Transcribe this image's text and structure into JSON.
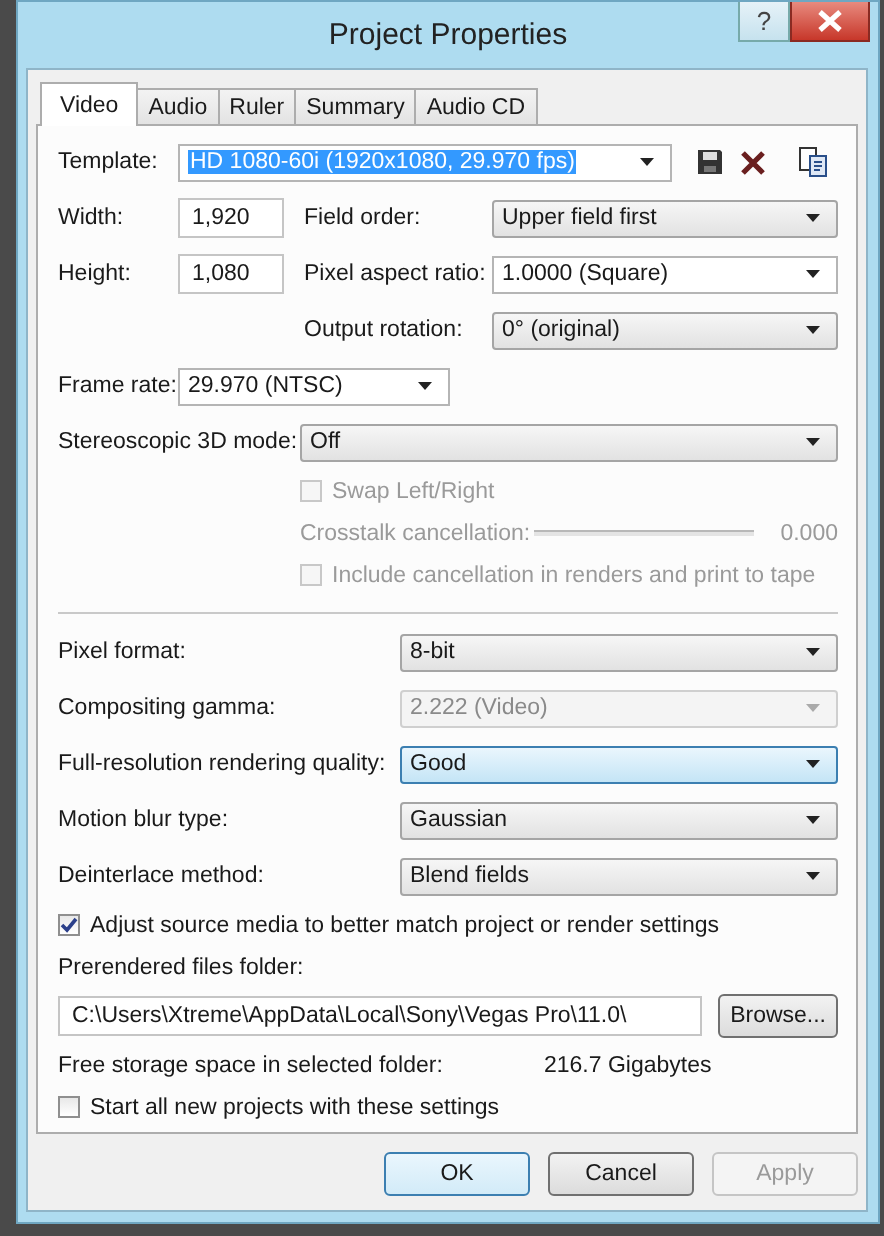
{
  "window": {
    "title": "Project Properties",
    "help": "?"
  },
  "tabs": [
    {
      "label": "Video",
      "selected": true
    },
    {
      "label": "Audio",
      "selected": false
    },
    {
      "label": "Ruler",
      "selected": false
    },
    {
      "label": "Summary",
      "selected": false
    },
    {
      "label": "Audio CD",
      "selected": false
    }
  ],
  "template": {
    "label": "Template:",
    "value": "HD 1080-60i (1920x1080, 29.970 fps)",
    "highlighted": true
  },
  "width": {
    "label": "Width:",
    "value": "1,920"
  },
  "height": {
    "label": "Height:",
    "value": "1,080"
  },
  "field_order": {
    "label": "Field order:",
    "value": "Upper field first"
  },
  "pixel_aspect_ratio": {
    "label": "Pixel aspect ratio:",
    "value": "1.0000 (Square)",
    "kind": "editable"
  },
  "output_rotation": {
    "label": "Output rotation:",
    "value": "0° (original)"
  },
  "frame_rate": {
    "label": "Frame rate:",
    "value": "29.970 (NTSC)"
  },
  "stereoscopic_3d_mode": {
    "label": "Stereoscopic 3D mode:",
    "value": "Off"
  },
  "swap_left_right": {
    "label": "Swap Left/Right",
    "checked": false,
    "disabled": true
  },
  "crosstalk_cancellation": {
    "label": "Crosstalk cancellation:",
    "reading": "0.000",
    "disabled": true
  },
  "include_cancellation": {
    "label": "Include cancellation in renders and print to tape",
    "checked": false,
    "disabled": true
  },
  "settings": [
    {
      "label": "Pixel format:",
      "value": "8-bit",
      "disabled": false,
      "focused": false
    },
    {
      "label": "Compositing gamma:",
      "value": "2.222 (Video)",
      "disabled": true,
      "focused": false
    },
    {
      "label": "Full-resolution rendering quality:",
      "value": "Good",
      "disabled": false,
      "focused": true
    },
    {
      "label": "Motion blur type:",
      "value": "Gaussian",
      "disabled": false,
      "focused": false
    },
    {
      "label": "Deinterlace method:",
      "value": "Blend fields",
      "disabled": false,
      "focused": false
    }
  ],
  "adjust_source_media": {
    "label": "Adjust source media to better match project or render settings",
    "checked": true
  },
  "prerendered_files_folder": {
    "label": "Prerendered files folder:",
    "value": "C:\\Users\\Xtreme\\AppData\\Local\\Sony\\Vegas Pro\\11.0\\",
    "button": "Browse..."
  },
  "free_storage": {
    "label": "Free storage space in selected folder:",
    "value": "216.7 Gigabytes"
  },
  "start_all_new_projects": {
    "label": "Start all new projects with these settings",
    "checked": false
  },
  "buttons": [
    {
      "label": "OK",
      "default": true,
      "disabled": false
    },
    {
      "label": "Cancel",
      "default": false,
      "disabled": false
    },
    {
      "label": "Apply",
      "default": false,
      "disabled": true
    }
  ]
}
